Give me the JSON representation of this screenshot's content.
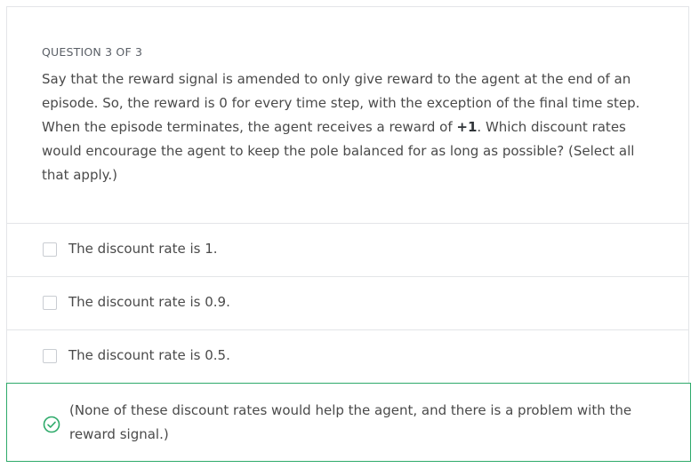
{
  "question": {
    "header": "QUESTION 3 OF 3",
    "text_part1": "Say that the reward signal is amended to only give reward to the agent at the end of an episode. So, the reward is 0 for every time step, with the exception of the final time step. When the episode terminates, the agent receives a reward of ",
    "text_bold": "+1",
    "text_part2": ". Which discount rates would encourage the agent to keep the pole balanced for as long as possible? (Select all that apply.)"
  },
  "options": [
    {
      "label": "The discount rate is 1.",
      "selected": false
    },
    {
      "label": "The discount rate is 0.9.",
      "selected": false
    },
    {
      "label": "The discount rate is 0.5.",
      "selected": false
    },
    {
      "label": "(None of these discount rates would help the agent, and there is a problem with the reward signal.)",
      "selected": true
    }
  ],
  "colors": {
    "correct": "#2eaa6a",
    "border": "#e3e5e8",
    "text": "#4a4a4a"
  },
  "icons": {
    "selected_option": "check-circle-icon",
    "unselected_option": "checkbox-icon"
  }
}
